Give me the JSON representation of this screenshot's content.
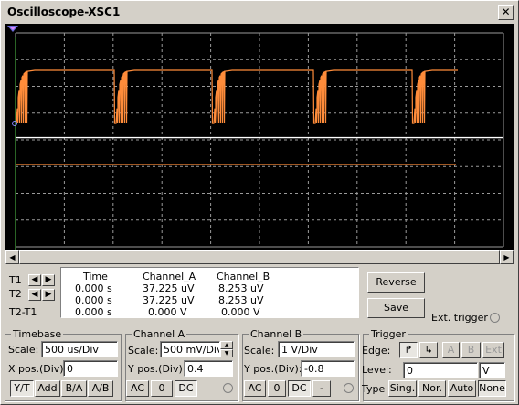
{
  "window": {
    "title": "Oscilloscope-XSC1",
    "close_glyph": "✕"
  },
  "colors": {
    "channel_a": "#ff8c3a",
    "channel_b": "#ffffff",
    "grid": "#9a9a9a",
    "screen_bg": "#000000",
    "cursor_t1": "#55c84a",
    "cursor_t2": "#6a6ad8"
  },
  "screen": {
    "dashed_grid": true,
    "h_divisions": 10,
    "v_divisions": 8
  },
  "readout": {
    "headers": [
      "Time",
      "Channel_A",
      "Channel_B"
    ],
    "rows": [
      {
        "label": "T1",
        "time": "0.000 s",
        "a": "37.225 uV",
        "b": "8.253 uV"
      },
      {
        "label": "T2",
        "time": "0.000 s",
        "a": "37.225 uV",
        "b": "8.253 uV"
      },
      {
        "label": "T2-T1",
        "time": "0.000 s",
        "a": "0.000 V",
        "b": "0.000 V"
      }
    ]
  },
  "buttons": {
    "reverse": "Reverse",
    "save": "Save"
  },
  "ext_trigger": "Ext. trigger",
  "timebase": {
    "title": "Timebase",
    "scale_label": "Scale:",
    "scale": "500 us/Div",
    "xpos_label": "X pos.(Div):",
    "xpos": "0",
    "modes": [
      "Y/T",
      "Add",
      "B/A",
      "A/B"
    ]
  },
  "channel_a": {
    "title": "Channel A",
    "scale_label": "Scale:",
    "scale": "500 mV/Div",
    "ypos_label": "Y pos.(Div):",
    "ypos": "0.4",
    "coupling": [
      "AC",
      "0",
      "DC"
    ]
  },
  "channel_b": {
    "title": "Channel B",
    "scale_label": "Scale:",
    "scale": "1  V/Div",
    "ypos_label": "Y pos.(Div):",
    "ypos": "-0.8",
    "coupling": [
      "AC",
      "0",
      "DC",
      "-"
    ]
  },
  "trigger": {
    "title": "Trigger",
    "edge_label": "Edge:",
    "edge_sources": [
      "A",
      "B",
      "Ext"
    ],
    "level_label": "Level:",
    "level": "0",
    "level_unit": "V",
    "type_label": "Type",
    "types": [
      "Sing.",
      "Nor.",
      "Auto",
      "None"
    ]
  }
}
